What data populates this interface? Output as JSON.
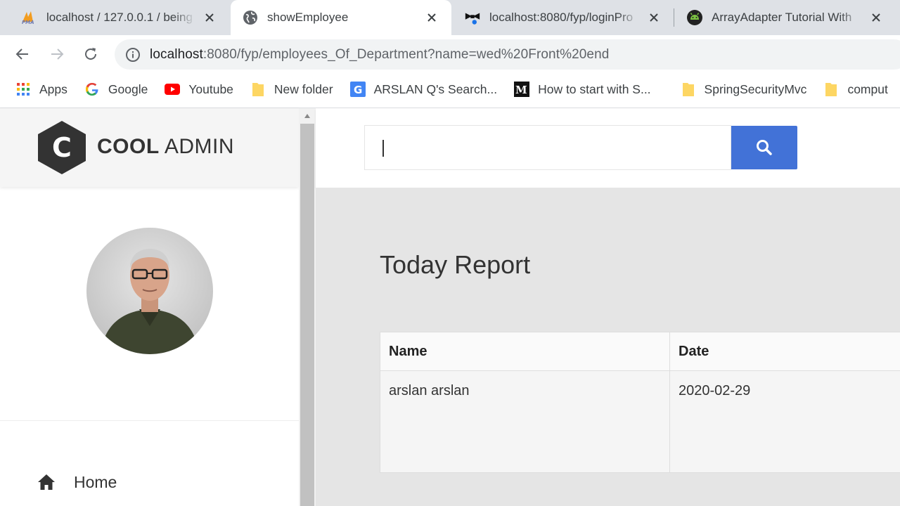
{
  "browser": {
    "tabs": [
      {
        "title": "localhost / 127.0.0.1 / being",
        "icon": "phpmyadmin-icon",
        "active": false
      },
      {
        "title": "showEmployee",
        "icon": "globe-icon",
        "active": true
      },
      {
        "title": "localhost:8080/fyp/loginPro",
        "icon": "bowtie-icon",
        "active": false
      },
      {
        "title": "ArrayAdapter Tutorial With",
        "icon": "android-icon",
        "active": false
      }
    ],
    "url_host": "localhost",
    "url_path": ":8080/fyp/employees_Of_Department?name=wed%20Front%20end",
    "bookmarks": [
      {
        "label": "Apps",
        "icon": "apps-grid-icon"
      },
      {
        "label": "Google",
        "icon": "google-icon"
      },
      {
        "label": "Youtube",
        "icon": "youtube-icon"
      },
      {
        "label": "New folder",
        "icon": "folder-icon"
      },
      {
        "label": "ARSLAN Q's Search...",
        "icon": "g-bookmark-icon"
      },
      {
        "label": "How to start with S...",
        "icon": "medium-icon"
      },
      {
        "label": "SpringSecurityMvc",
        "icon": "folder-icon"
      },
      {
        "label": "comput",
        "icon": "folder-icon"
      }
    ]
  },
  "sidebar": {
    "logo_bold": "COOL",
    "logo_light": "ADMIN",
    "logo_letter": "C",
    "nav": [
      {
        "label": "Home",
        "icon": "home-icon"
      }
    ]
  },
  "header": {
    "search_placeholder": ""
  },
  "main": {
    "title": "Today Report",
    "table": {
      "columns": [
        "Name",
        "Date"
      ],
      "rows": [
        [
          "arslan arslan",
          "2020-02-29"
        ]
      ]
    }
  },
  "colors": {
    "accent": "#4272d7",
    "content_bg": "#e5e5e5",
    "tabstrip_bg": "#dee1e6"
  }
}
